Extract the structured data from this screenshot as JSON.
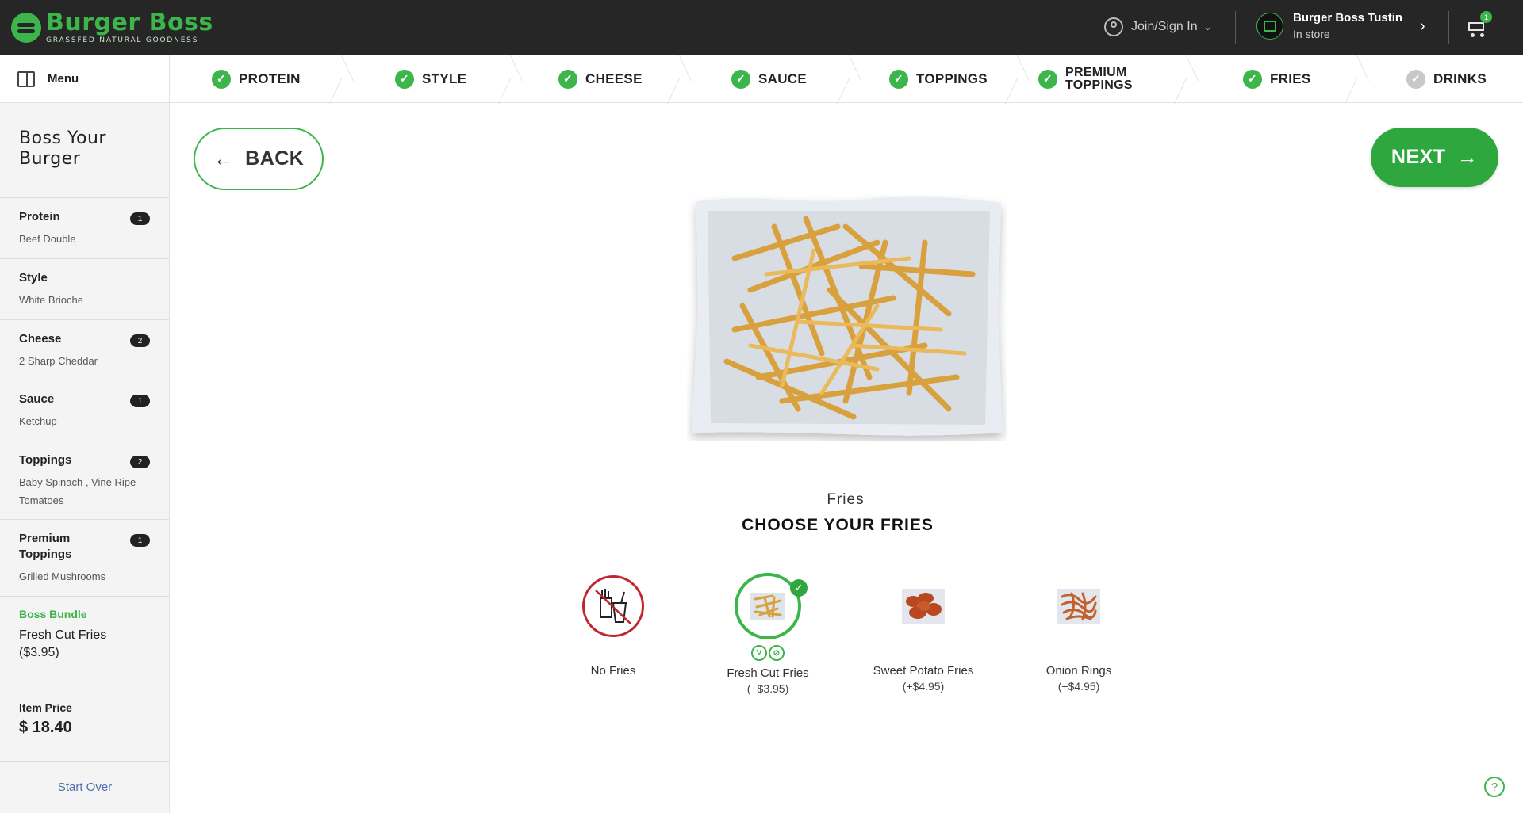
{
  "header": {
    "logo_title": "Burger Boss",
    "logo_subtitle": "GRASSFED NATURAL GOODNESS",
    "join_label": "Join/Sign In",
    "store_name": "Burger Boss Tustin",
    "store_mode": "In store",
    "cart_count": "1"
  },
  "nav": {
    "menu_label": "Menu",
    "steps": [
      {
        "label": "PROTEIN",
        "done": true
      },
      {
        "label": "STYLE",
        "done": true
      },
      {
        "label": "CHEESE",
        "done": true
      },
      {
        "label": "SAUCE",
        "done": true
      },
      {
        "label": "TOPPINGS",
        "done": true
      },
      {
        "label": "PREMIUM TOPPINGS",
        "done": true
      },
      {
        "label": "FRIES",
        "done": true
      },
      {
        "label": "DRINKS",
        "done": false
      }
    ]
  },
  "sidebar": {
    "title": "Boss Your Burger",
    "items": [
      {
        "name": "Protein",
        "value": "Beef Double",
        "count": "1"
      },
      {
        "name": "Style",
        "value": "White Brioche",
        "count": ""
      },
      {
        "name": "Cheese",
        "value": "2 Sharp Cheddar",
        "count": "2"
      },
      {
        "name": "Sauce",
        "value": "Ketchup",
        "count": "1"
      },
      {
        "name": "Toppings",
        "value": "Baby Spinach , Vine Ripe Tomatoes",
        "count": "2"
      },
      {
        "name": "Premium Toppings",
        "value": "Grilled Mushrooms",
        "count": "1"
      }
    ],
    "bundle_name": "Boss Bundle",
    "bundle_value": "Fresh Cut Fries ($3.95)",
    "price_label": "Item Price",
    "price_value": "$ 18.40",
    "start_over": "Start Over"
  },
  "main": {
    "back_label": "BACK",
    "next_label": "NEXT",
    "category_label": "Fries",
    "category_title": "CHOOSE YOUR FRIES",
    "options": [
      {
        "name": "No Fries",
        "price": "",
        "selected": false
      },
      {
        "name": "Fresh Cut Fries",
        "price": "(+$3.95)",
        "selected": true
      },
      {
        "name": "Sweet Potato Fries",
        "price": "(+$4.95)",
        "selected": false
      },
      {
        "name": "Onion Rings",
        "price": "(+$4.95)",
        "selected": false
      }
    ]
  },
  "colors": {
    "accent_green": "#3cb54a",
    "header_bg": "#262626",
    "no_option_red": "#c0262d"
  }
}
